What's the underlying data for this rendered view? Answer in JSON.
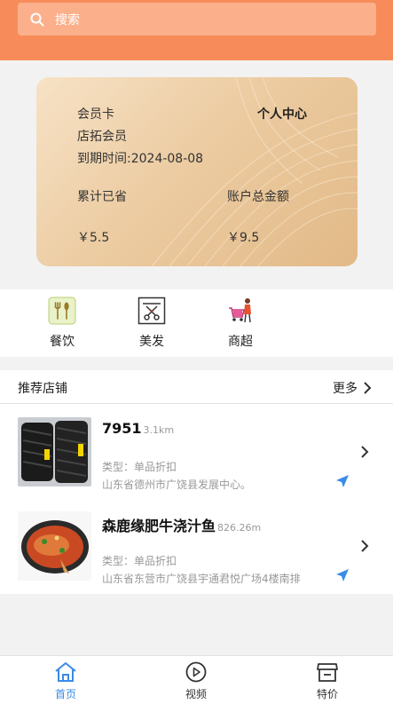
{
  "search": {
    "placeholder": "搜索"
  },
  "member_card": {
    "title": "会员卡",
    "personal_center": "个人中心",
    "store_member": "店拓会员",
    "expire": "到期时间:2024-08-08",
    "saved_label": "累计已省",
    "balance_label": "账户总金额",
    "saved_value": "￥5.5",
    "balance_value": "￥9.5"
  },
  "categories": [
    {
      "label": "餐饮",
      "icon": "dining-icon"
    },
    {
      "label": "美发",
      "icon": "hairdressing-icon"
    },
    {
      "label": "商超",
      "icon": "supermarket-icon"
    }
  ],
  "shops": {
    "title": "推荐店铺",
    "more": "更多",
    "items": [
      {
        "name": "7951",
        "distance": "3.1km",
        "type": "类型：单品折扣",
        "address": "山东省德州市广饶县发展中心。"
      },
      {
        "name": "森鹿缘肥牛浇汁鱼",
        "distance": "826.26m",
        "type": "类型：单品折扣",
        "address": "山东省东营市广饶县宇通君悦广场4楼南排"
      }
    ]
  },
  "tabs": [
    {
      "label": "首页",
      "icon": "home-icon",
      "active": true
    },
    {
      "label": "视频",
      "icon": "play-icon",
      "active": false
    },
    {
      "label": "特价",
      "icon": "store-icon",
      "active": false
    }
  ],
  "colors": {
    "header": "#f78c5a",
    "accent": "#3a8be8"
  }
}
